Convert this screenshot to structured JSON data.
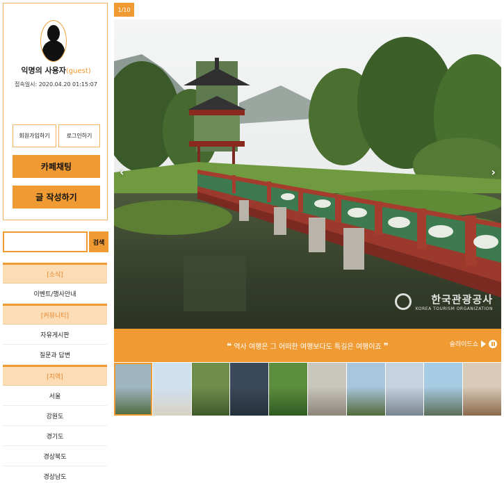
{
  "profile": {
    "username": "익명의 사용자",
    "role": "(guest)",
    "login_time": "접속일시: 2020.04.20 01:15:07",
    "join_label": "회원가입하기",
    "login_label": "로그인하기",
    "chat_label": "카페채팅",
    "write_label": "글 작성하기"
  },
  "search": {
    "placeholder": "",
    "button_label": "검색"
  },
  "nav": {
    "news_header": "[소식]",
    "news_items": [
      "이벤트/행사안내"
    ],
    "community_header": "[커뮤니티]",
    "community_items": [
      "자유게시판",
      "질문과 답변"
    ],
    "region_header": "[지역]",
    "region_items": [
      "서울",
      "강원도",
      "경기도",
      "경상북도",
      "경상남도"
    ]
  },
  "slider": {
    "counter": "1/10",
    "prev_arrow": "‹",
    "next_arrow": "›",
    "watermark_kr": "한국관광공사",
    "watermark_en": "KOREA TOURISM ORGANIZATION",
    "quote_open": "❝",
    "quote_text": "역사 여행은 그 어떠한 여행보다도 특길은 여행이죠",
    "quote_close": "❞",
    "slideshow_label": "슬라이드쇼"
  },
  "colors": {
    "accent": "#ef9a32",
    "accent_light": "#fbdcb5",
    "guest": "#f0962a"
  },
  "thumbnails": [
    {
      "name": "pavilion-bridge",
      "top": "#9fb6c2",
      "bottom": "#4e6b3c",
      "active": true
    },
    {
      "name": "palace-gate-snow",
      "top": "#cfe1ef",
      "bottom": "#d8d2c2",
      "active": false
    },
    {
      "name": "forest-temple",
      "top": "#6f8e4c",
      "bottom": "#3f5a2c",
      "active": false
    },
    {
      "name": "dark-pagoda",
      "top": "#3b4a5a",
      "bottom": "#25303a",
      "active": false
    },
    {
      "name": "green-garden",
      "top": "#5d8e3e",
      "bottom": "#2f5a22",
      "active": false
    },
    {
      "name": "stone-statue",
      "top": "#c9c6be",
      "bottom": "#8c857a",
      "active": false
    },
    {
      "name": "pavilion-trees",
      "top": "#a9c6de",
      "bottom": "#526b3a",
      "active": false
    },
    {
      "name": "snow-mountain",
      "top": "#c5d2e0",
      "bottom": "#7a8590",
      "active": false
    },
    {
      "name": "coast-rocks",
      "top": "#a7cbe2",
      "bottom": "#5b6e58",
      "active": false
    },
    {
      "name": "autumn-path",
      "top": "#d9cbb8",
      "bottom": "#8a6a4c",
      "active": false
    }
  ]
}
